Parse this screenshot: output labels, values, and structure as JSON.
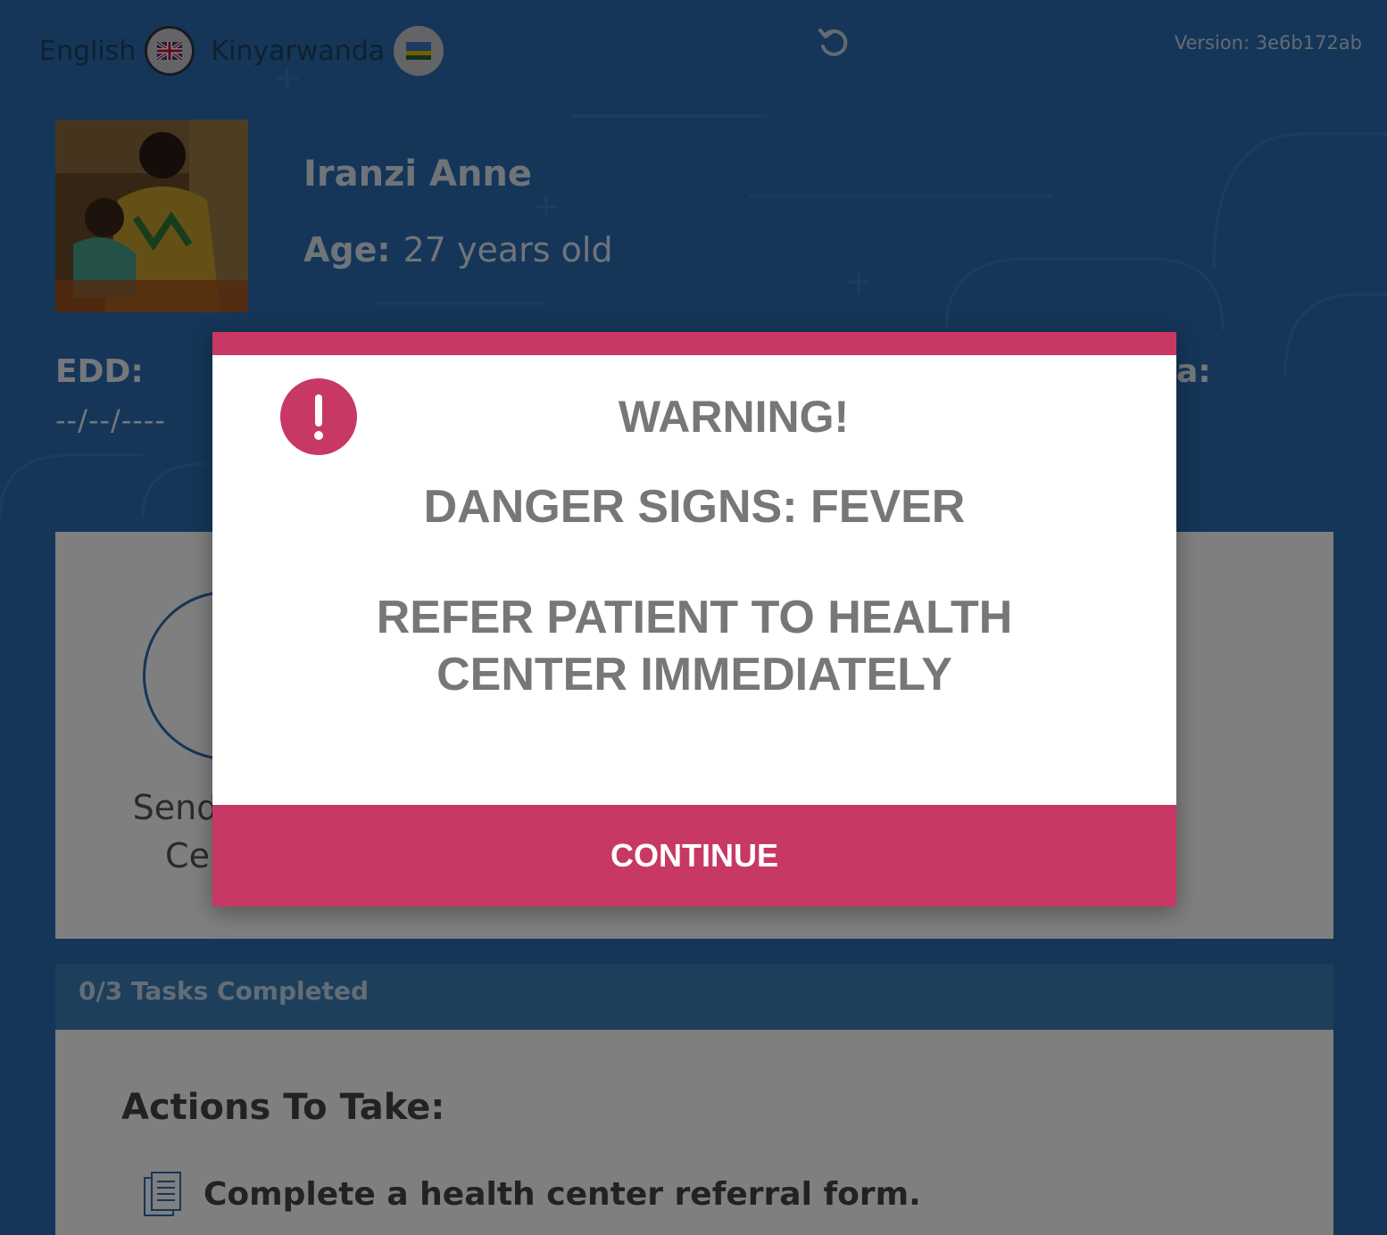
{
  "header": {
    "languages": [
      {
        "label": "English",
        "flag_icon": "uk-flag-icon",
        "active": true
      },
      {
        "label": "Kinyarwanda",
        "flag_icon": "rwanda-flag-icon",
        "active": false
      }
    ],
    "reload_icon": "reload-icon",
    "version": "Version: 3e6b172ab"
  },
  "patient": {
    "name": "Iranzi Anne",
    "age_label": "Age:",
    "age_value": "27 years old",
    "edd_label": "EDD:",
    "edd_value": "--/--/----",
    "right_label": "a:"
  },
  "card": {
    "send_text": "Send t Ce",
    "send_line1": "Send t",
    "send_line2": "Ce"
  },
  "tasks": {
    "completed_label": "0/3 Tasks Completed",
    "actions_heading": "Actions To Take:",
    "items": [
      "Complete a health center referral form."
    ]
  },
  "modal": {
    "title": "WARNING!",
    "message1": "DANGER SIGNS: FEVER",
    "message2": "REFER PATIENT TO HEALTH CENTER IMMEDIATELY",
    "button": "CONTINUE",
    "accent_color": "#c83865"
  }
}
